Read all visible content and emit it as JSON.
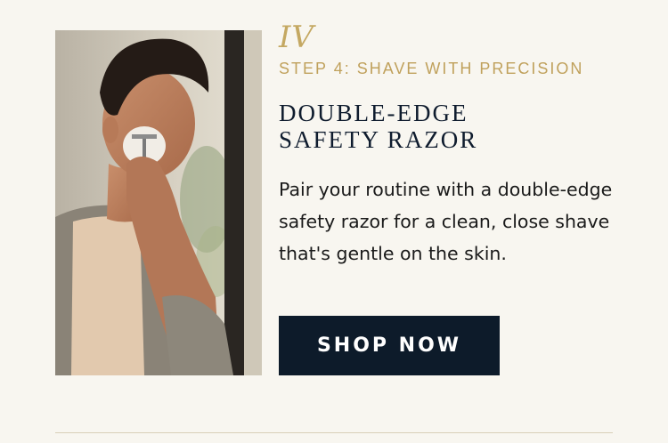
{
  "product": {
    "image_alt": "Man shaving with a double-edge safety razor",
    "numeral": "IV",
    "step": "STEP 4: SHAVE WITH PRECISION",
    "title_line1": "DOUBLE-EDGE",
    "title_line2": "SAFETY RAZOR",
    "description": "Pair your routine with a double-edge safety razor for a clean, close shave that's gentle on the skin.",
    "cta_label": "SHOP NOW"
  },
  "colors": {
    "background": "#f8f6f0",
    "accent_gold": "#c0a15c",
    "navy": "#0d1b2a",
    "text": "#1a1a1a"
  }
}
